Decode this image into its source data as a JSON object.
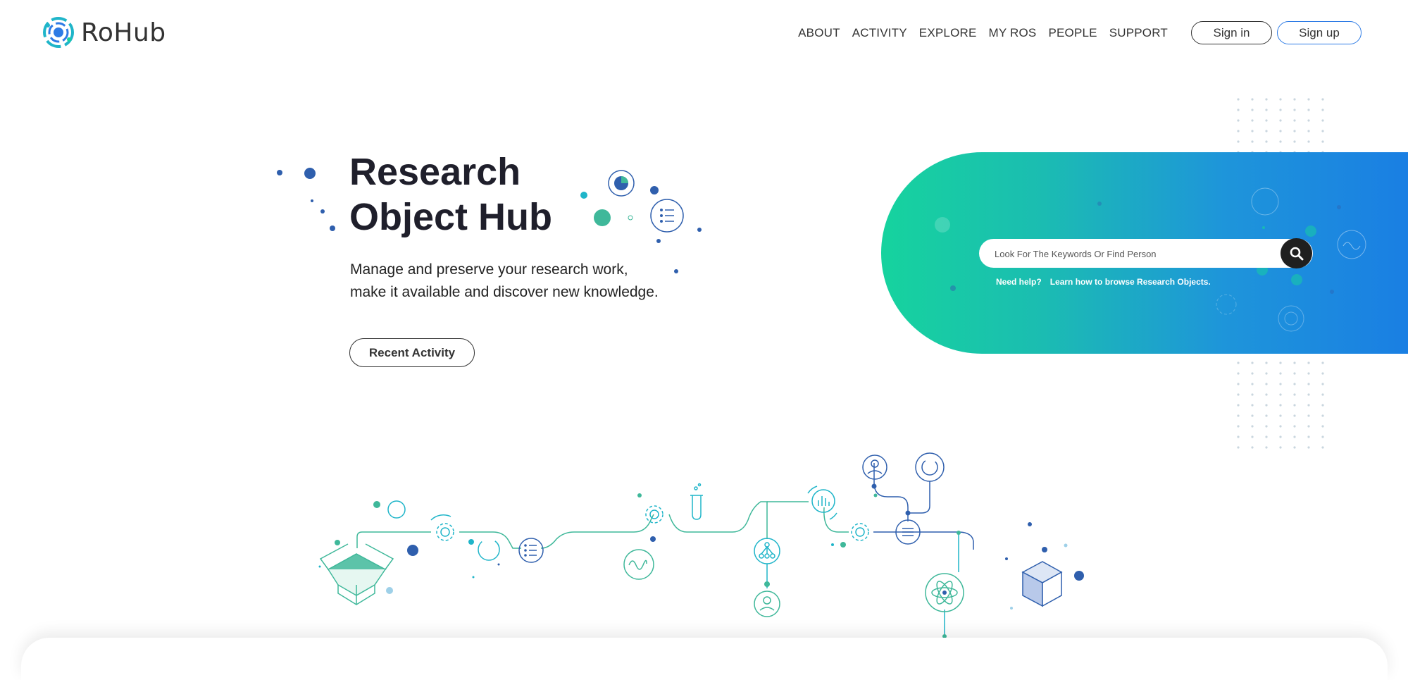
{
  "header": {
    "logo_text": "RoHub",
    "nav": [
      {
        "label": "ABOUT"
      },
      {
        "label": "ACTIVITY"
      },
      {
        "label": "EXPLORE"
      },
      {
        "label": "MY ROS"
      },
      {
        "label": "PEOPLE"
      },
      {
        "label": "SUPPORT"
      }
    ],
    "signin_label": "Sign in",
    "signup_label": "Sign up"
  },
  "hero": {
    "title_line1": "Research",
    "title_line2": "Object Hub",
    "subtitle_line1": "Manage and preserve your research work,",
    "subtitle_line2": "make it available and discover new knowledge.",
    "recent_activity_label": "Recent Activity"
  },
  "search": {
    "placeholder": "Look For The Keywords Or Find Person",
    "value": "",
    "button_icon": "search-icon",
    "help_label": "Need help?",
    "help_link": "Learn how to browse Research Objects."
  },
  "colors": {
    "accent_blue": "#2d7be5",
    "gradient_start": "#16d39e",
    "gradient_end": "#1a7fe3",
    "illustration_teal": "#3fb89a",
    "illustration_blue": "#2f5fad"
  }
}
